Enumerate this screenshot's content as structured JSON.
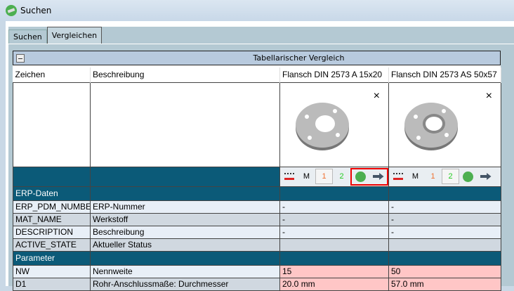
{
  "window": {
    "title": "Suchen"
  },
  "tabs": [
    {
      "label": "Suchen"
    },
    {
      "label": "Vergleichen"
    }
  ],
  "comparison": {
    "title": "Tabellarischer Vergleich"
  },
  "columns": {
    "sign": "Zeichen",
    "description": "Beschreibung",
    "part1": "Flansch DIN 2573 A 15x20",
    "part2": "Flansch DIN 2573 AS 50x57"
  },
  "toolbar": {
    "m": "M",
    "one": "1",
    "two": "2",
    "close": "×"
  },
  "sections": {
    "erp": "ERP-Daten",
    "param": "Parameter"
  },
  "rows": [
    {
      "sign": "ERP_PDM_NUMBER",
      "desc": "ERP-Nummer",
      "v1": "-",
      "v2": "-"
    },
    {
      "sign": "MAT_NAME",
      "desc": "Werkstoff",
      "v1": "-",
      "v2": "-"
    },
    {
      "sign": "DESCRIPTION",
      "desc": "Beschreibung",
      "v1": "-",
      "v2": "-"
    },
    {
      "sign": "ACTIVE_STATE",
      "desc": "Aktueller Status",
      "v1": "",
      "v2": ""
    },
    {
      "sign": "NW",
      "desc": "Nennweite",
      "v1": "15",
      "v2": "50"
    },
    {
      "sign": "D1",
      "desc": "Rohr-Anschlussmaße: Durchmesser",
      "v1": "20.0 mm",
      "v2": "57.0 mm"
    }
  ],
  "colors": {
    "section": "#0b5a78",
    "highlight": "#ffc6c6",
    "accent_box": "#e00000"
  }
}
